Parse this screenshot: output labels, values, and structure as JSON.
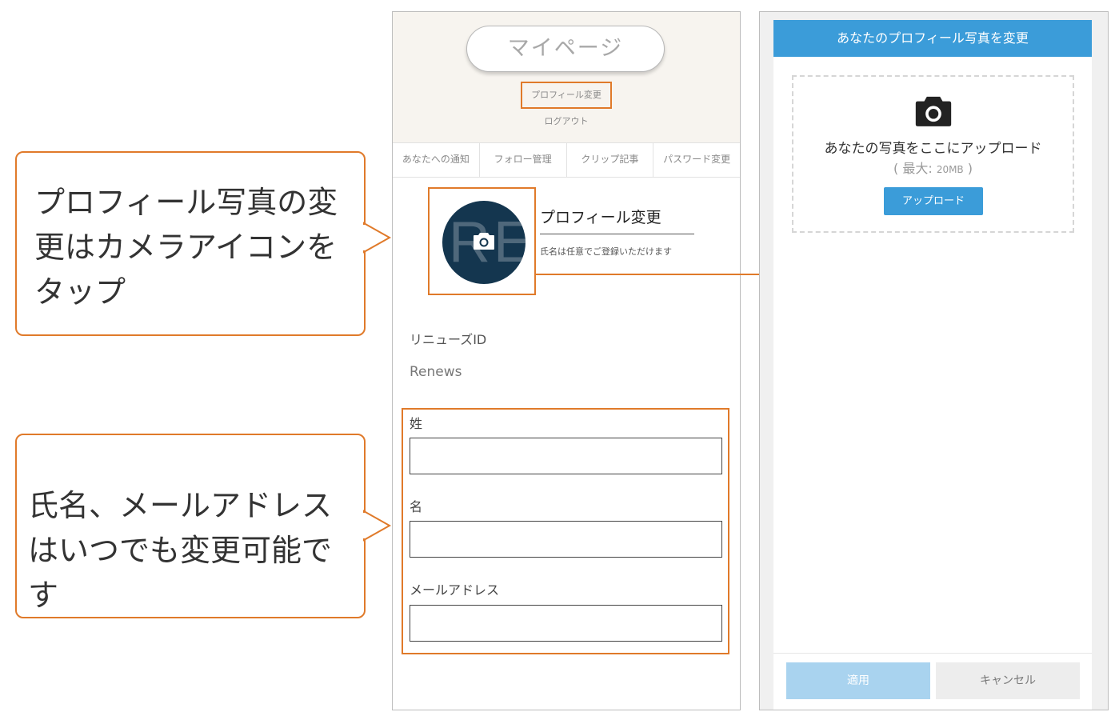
{
  "callouts": {
    "camera_tip": "プロフィール写真の変更はカメラアイコンをタップ",
    "fields_tip": "氏名、メールアドレスはいつでも変更可能です"
  },
  "left_screen": {
    "mypage_title": "マイページ",
    "profile_change_link": "プロフィール変更",
    "logout_link": "ログアウト",
    "tabs": [
      "あなたへの通知",
      "フォロー管理",
      "クリップ記事",
      "パスワード変更"
    ],
    "avatar_letters": "RE",
    "section_title": "プロフィール変更",
    "section_subtitle": "氏名は任意でご登録いただけます",
    "renews_id_label": "リニューズID",
    "renews_id_value": "Renews",
    "fields": {
      "last_name_label": "姓",
      "first_name_label": "名",
      "email_label": "メールアドレス",
      "last_name_value": "",
      "first_name_value": "",
      "email_value": ""
    }
  },
  "right_screen": {
    "dialog_title": "あなたのプロフィール写真を変更",
    "dropzone_text": "あなたの写真をここにアップロード",
    "limit_prefix": "( 最大: ",
    "limit_size": "20MB",
    "limit_suffix": " )",
    "upload_button": "アップロード",
    "apply_button": "適用",
    "cancel_button": "キャンセル"
  },
  "colors": {
    "highlight_orange": "#e07a2a",
    "accent_blue": "#3b9cd9",
    "avatar_navy": "#14364f",
    "header_beige": "#f7f4ef"
  },
  "icons": {
    "avatar_camera": "camera-icon",
    "dropzone_camera": "camera-icon",
    "arrow": "arrow-right-icon"
  }
}
